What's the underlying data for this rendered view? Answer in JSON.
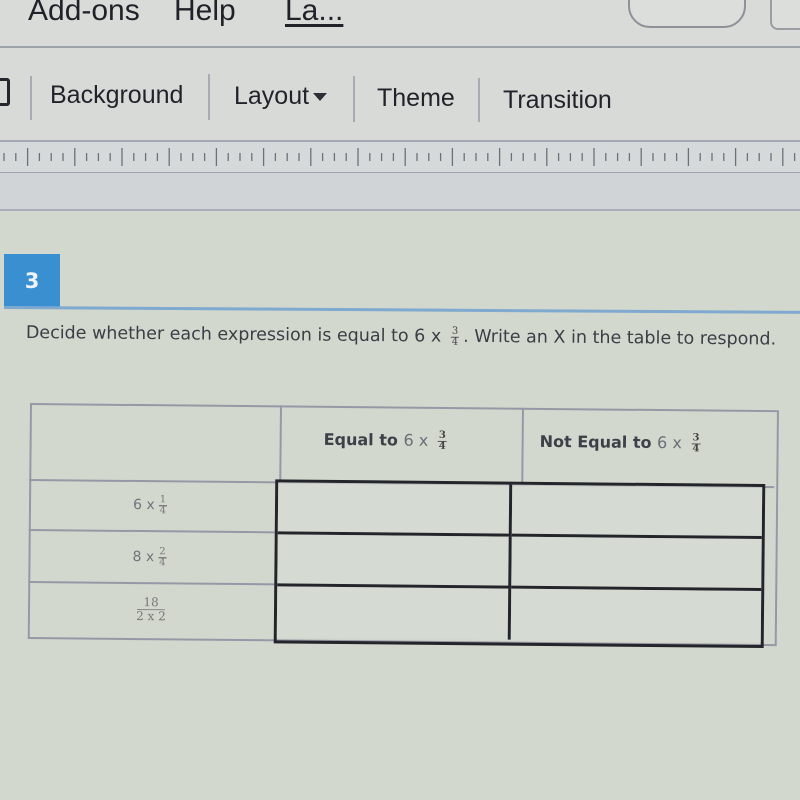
{
  "menubar": {
    "items": [
      "Add-ons",
      "Help",
      "La..."
    ]
  },
  "toolbar": {
    "items": [
      "Background",
      "Layout",
      "Theme",
      "Transition"
    ]
  },
  "question": {
    "number": "3",
    "prompt_part1": "Decide whether each expression is equal to 6 x",
    "prompt_frac": {
      "num": "3",
      "den": "4"
    },
    "prompt_part2": ". Write an X in the table to respond.",
    "table": {
      "headers": [
        {
          "bold": "Equal to",
          "light": "6 x",
          "frac": {
            "num": "3",
            "den": "4"
          }
        },
        {
          "bold": "Not Equal to",
          "light": "6 x",
          "frac": {
            "num": "3",
            "den": "4"
          }
        }
      ],
      "rows": [
        {
          "lead": "6 x",
          "frac": {
            "num": "1",
            "den": "4"
          },
          "answers": [
            "",
            ""
          ]
        },
        {
          "lead": "8 x",
          "frac": {
            "num": "2",
            "den": "4"
          },
          "answers": [
            "",
            ""
          ]
        },
        {
          "lead": "",
          "frac": {
            "num": "18",
            "den": "2 x 2"
          },
          "answers": [
            "",
            ""
          ]
        }
      ]
    }
  }
}
